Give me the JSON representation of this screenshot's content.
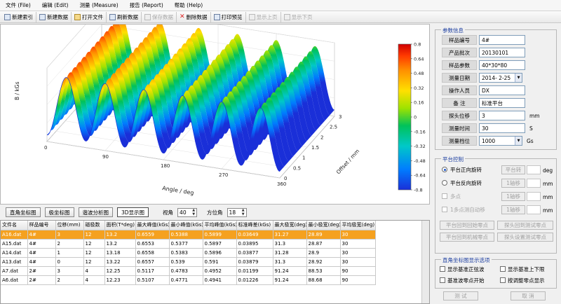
{
  "menu": [
    "文件 (File)",
    "编辑 (Edit)",
    "测量 (Measure)",
    "报告 (Report)",
    "帮助 (Help)"
  ],
  "toolbar": [
    {
      "label": "新建索引",
      "icon": "new-index-icon",
      "enabled": true
    },
    {
      "label": "新建数据",
      "icon": "new-data-icon",
      "enabled": true
    },
    {
      "label": "打开文件",
      "icon": "open-folder-icon",
      "enabled": true
    },
    {
      "label": "刷新数据",
      "icon": "refresh-icon",
      "enabled": true
    },
    {
      "label": "保存数据",
      "icon": "save-icon",
      "enabled": false
    },
    {
      "label": "删除数据",
      "icon": "delete-icon",
      "enabled": true
    },
    {
      "label": "打印预览",
      "icon": "print-preview-icon",
      "enabled": true
    },
    {
      "label": "显示上页",
      "icon": "page-up-icon",
      "enabled": false
    },
    {
      "label": "显示下页",
      "icon": "page-down-icon",
      "enabled": false
    }
  ],
  "chart_data": {
    "type": "surface",
    "x": {
      "label": "Angle / deg",
      "ticks": [
        0,
        90,
        180,
        270,
        360
      ],
      "range": [
        0,
        360
      ]
    },
    "y": {
      "label": "Offset / mm",
      "ticks": [
        0,
        0.5,
        1,
        1.5,
        2,
        2.5,
        3
      ],
      "range": [
        0,
        3
      ]
    },
    "z": {
      "label": "B / kGs",
      "range": [
        -0.8,
        0.8
      ]
    },
    "peaks": 6,
    "colorbar": {
      "ticks": [
        "0.8",
        "0.64",
        "0.48",
        "0.32",
        "0.16",
        "0",
        "-0.16",
        "-0.32",
        "-0.48",
        "-0.64",
        "-0.8"
      ],
      "colors": [
        "#d00000",
        "#ff3a00",
        "#ff9000",
        "#ffe000",
        "#9ee200",
        "#00c25a",
        "#00c8c8",
        "#007cff",
        "#1a2fd8"
      ]
    }
  },
  "view": {
    "buttons": [
      "直角坐标图",
      "极坐标图",
      "谐波分析图",
      "3D显示图"
    ],
    "active": "3D显示图",
    "angle_label": "视角",
    "angle_value": "40",
    "azimuth_label": "方位角",
    "azimuth_value": "18"
  },
  "table": {
    "headers": [
      "文件名",
      "样品编号",
      "位移(mm)",
      "磁极数",
      "面积(T*deg)",
      "最大峰值(kGs)",
      "最小峰值(kGs)",
      "平均峰值(kGs)",
      "标准峰差(kGs)",
      "最大极宽(deg)",
      "最小极宽(deg)",
      "平均极宽(deg)"
    ],
    "rows": [
      [
        "A16.dat",
        "4#",
        "3",
        "12",
        "13.2",
        "0.6559",
        "0.5388",
        "0.5899",
        "0.03649",
        "31.27",
        "28.89",
        "30"
      ],
      [
        "A15.dat",
        "4#",
        "2",
        "12",
        "13.2",
        "0.6553",
        "0.5377",
        "0.5897",
        "0.03895",
        "31.3",
        "28.87",
        "30"
      ],
      [
        "A14.dat",
        "4#",
        "1",
        "12",
        "13.18",
        "0.6558",
        "0.5383",
        "0.5896",
        "0.03877",
        "31.28",
        "28.9",
        "30"
      ],
      [
        "A13.dat",
        "4#",
        "0",
        "12",
        "13.22",
        "0.6557",
        "0.539",
        "0.591",
        "0.03879",
        "31.3",
        "28.92",
        "30"
      ],
      [
        "A7.dat",
        "2#",
        "3",
        "4",
        "12.25",
        "0.5117",
        "0.4783",
        "0.4952",
        "0.01199",
        "91.24",
        "88.53",
        "90"
      ],
      [
        "A6.dat",
        "2#",
        "2",
        "4",
        "12.23",
        "0.5107",
        "0.4771",
        "0.4941",
        "0.01226",
        "91.24",
        "88.68",
        "90"
      ]
    ],
    "selected_row": 0
  },
  "params": {
    "title": "参数信息",
    "fields": [
      {
        "label": "样品编号",
        "value": "4#",
        "unit": ""
      },
      {
        "label": "产品批次",
        "value": "20130101",
        "unit": ""
      },
      {
        "label": "样品参数",
        "value": "40*30*80",
        "unit": ""
      },
      {
        "label": "测量日期",
        "value": "2014- 2-25",
        "unit": ""
      },
      {
        "label": "操作人员",
        "value": "DX",
        "unit": ""
      },
      {
        "label": "备    注",
        "value": "标准平台",
        "unit": ""
      },
      {
        "label": "探头位移",
        "value": "3",
        "unit": "mm"
      },
      {
        "label": "测量时间",
        "value": "30",
        "unit": "S"
      },
      {
        "label": "测量档位",
        "value": "1000",
        "unit": "Gs"
      }
    ]
  },
  "platform": {
    "title": "平台控制",
    "forward": "平台正向旋转",
    "forward_btn": "平台转",
    "forward_unit": "deg",
    "reverse": "平台反向旋转",
    "reverse_btn": "1轴移",
    "reverse_unit": "mm",
    "multi": "多点",
    "multi_btn": "1轴移",
    "multi_unit": "mm",
    "auto": "1多点测自动移",
    "auto_btn": "1轴移",
    "auto_unit": "mm",
    "btn_platform_test": "平台回到回始零点",
    "btn_probe_test": "探头回到测试零点",
    "btn_platform_mech": "平台回到机械零点",
    "btn_probe_set": "探头设置测试零点"
  },
  "display": {
    "title": "直角坐标图显示选项",
    "opt1": "显示基准正弦波",
    "opt2": "显示基准上下限",
    "opt3": "基准波零点开始",
    "opt4": "按调整零点显示"
  },
  "footer": {
    "test": "测 试",
    "cancel": "取 消"
  }
}
